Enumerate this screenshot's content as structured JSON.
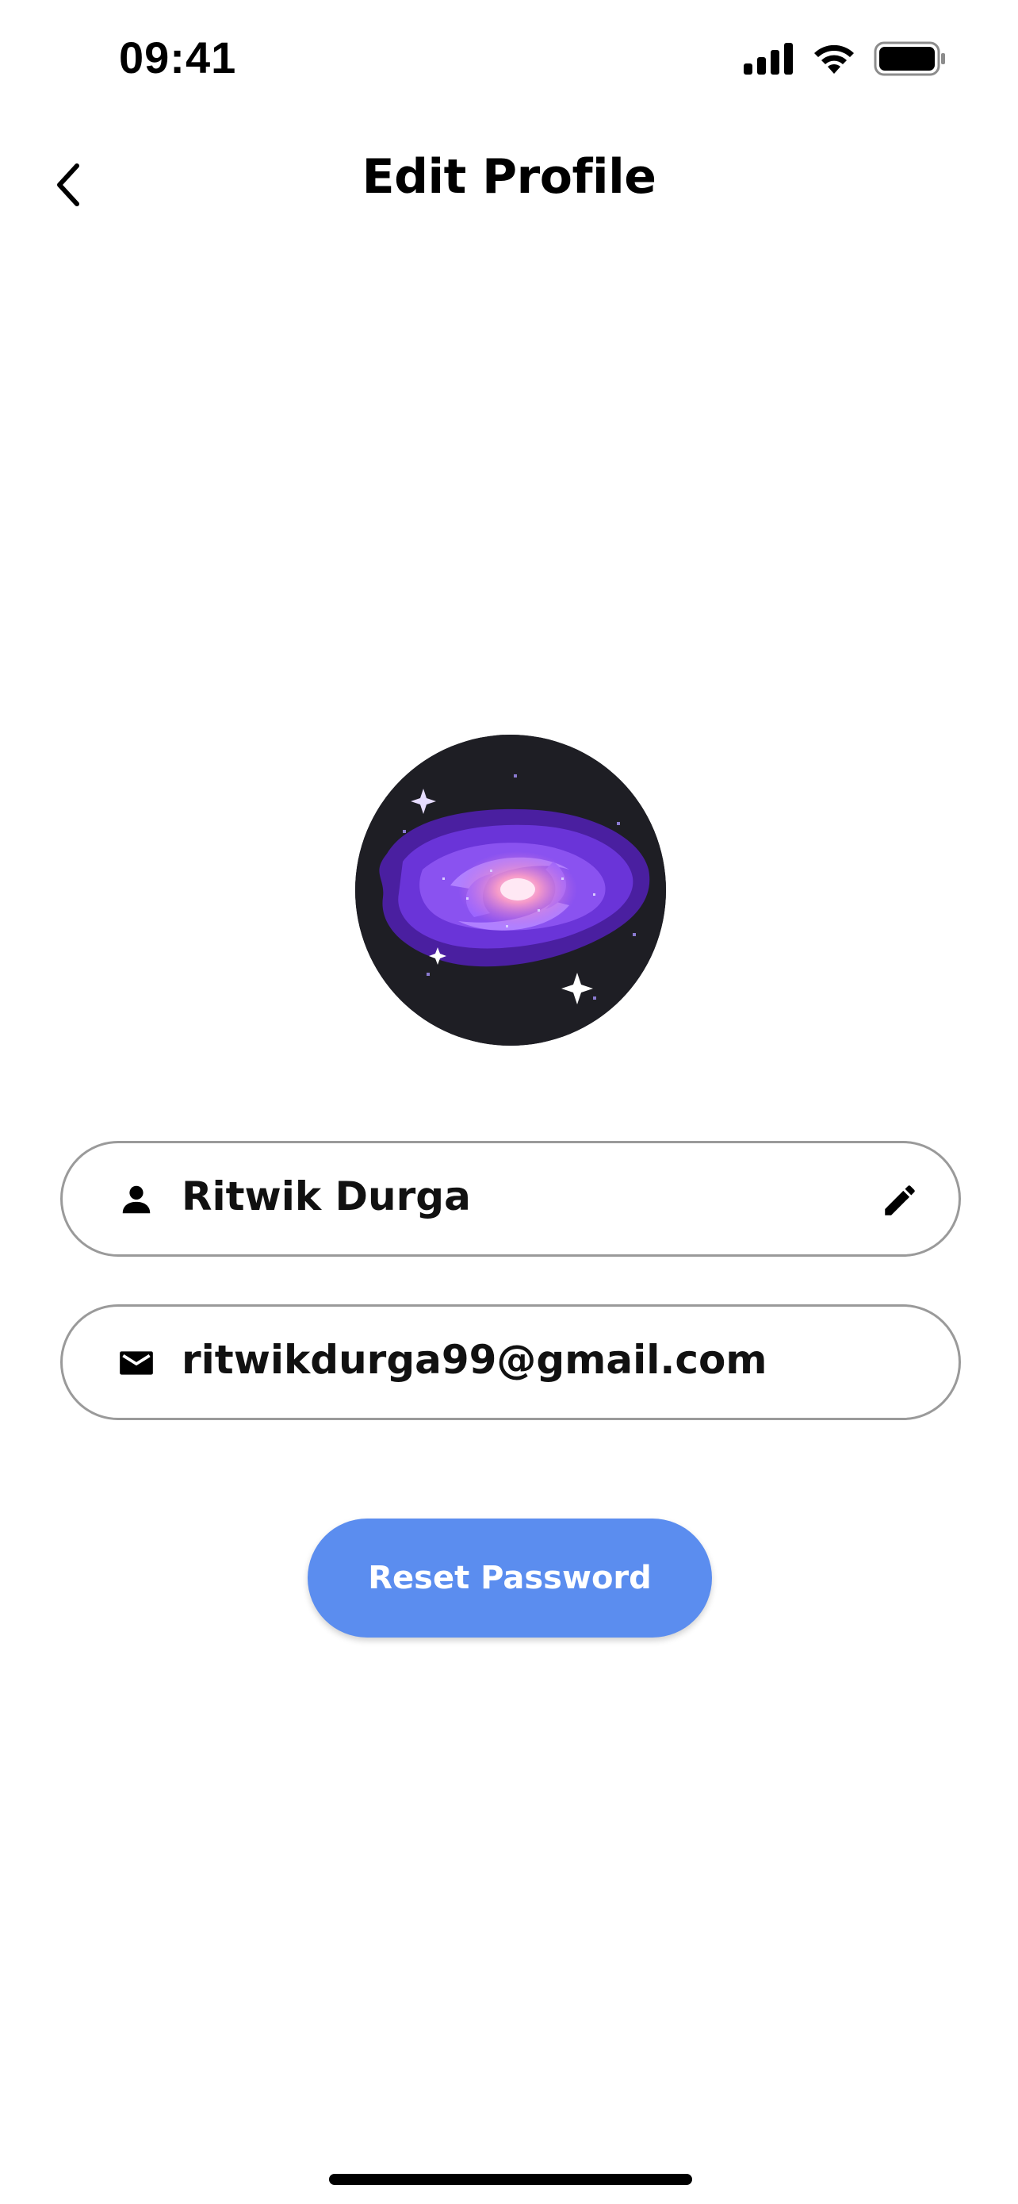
{
  "status_bar": {
    "time": "09:41"
  },
  "header": {
    "title": "Edit Profile",
    "back_icon": "chevron-left-icon"
  },
  "profile": {
    "avatar_description_icon": "galaxy-avatar",
    "name": "Ritwik Durga",
    "email": "ritwikdurga99@gmail.com"
  },
  "icons": {
    "name_field": "person-icon",
    "email_field": "mail-icon",
    "edit": "pencil-icon"
  },
  "actions": {
    "reset_password_label": "Reset Password"
  },
  "colors": {
    "primary_button": "#5b8def",
    "field_border": "#9a9a9a",
    "background": "#ffffff"
  }
}
